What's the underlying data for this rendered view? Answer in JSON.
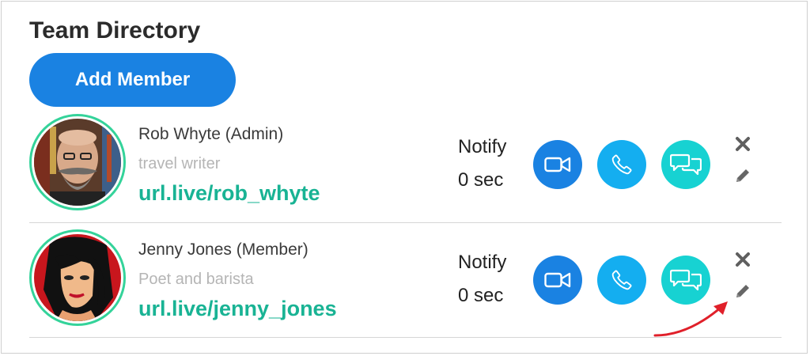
{
  "page": {
    "title": "Team Directory"
  },
  "toolbar": {
    "add_member_label": "Add Member"
  },
  "members": [
    {
      "name": "Rob Whyte (Admin)",
      "role": "travel writer",
      "link": "url.live/rob_whyte",
      "notify_label": "Notify",
      "notify_time": "0 sec"
    },
    {
      "name": "Jenny Jones (Member)",
      "role": "Poet and barista",
      "link": "url.live/jenny_jones",
      "notify_label": "Notify",
      "notify_time": "0 sec"
    }
  ],
  "colors": {
    "primary_button": "#1a82e2",
    "phone_button": "#14aef0",
    "chat_button": "#17d2d2",
    "link": "#19b394",
    "avatar_ring": "#34d39a",
    "annotation_arrow": "#e0202a"
  },
  "icons": [
    "video-icon",
    "phone-icon",
    "chat-icon",
    "delete-icon",
    "edit-icon"
  ]
}
